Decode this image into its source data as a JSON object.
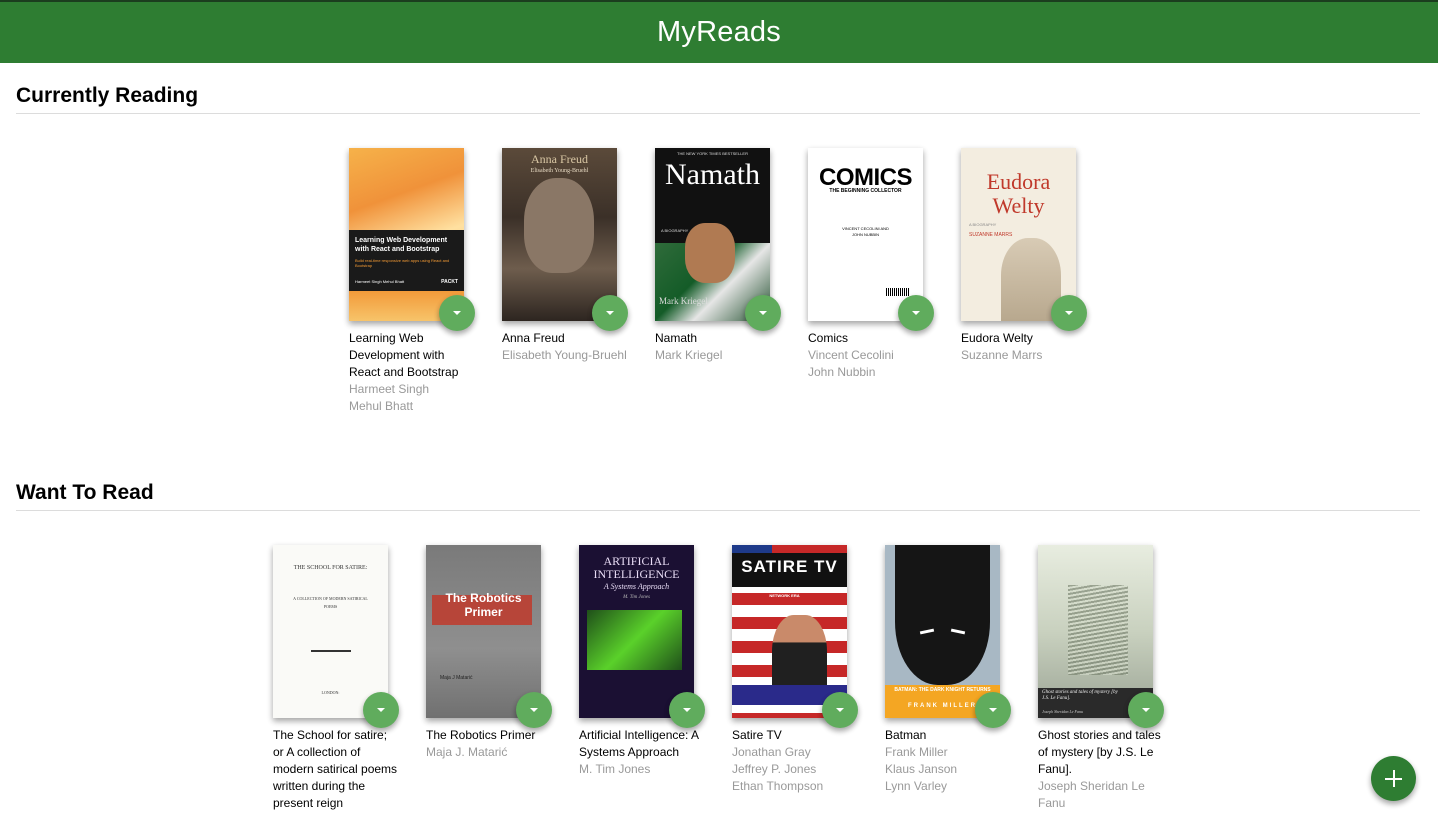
{
  "app": {
    "title": "MyReads"
  },
  "shelves": [
    {
      "title": "Currently Reading",
      "books": [
        {
          "title": "Learning Web Development with React and Bootstrap",
          "authors": [
            "Harmeet Singh",
            "Mehul Bhatt"
          ],
          "cover": {
            "title": "Learning Web Development with React and Bootstrap",
            "subtitle": "Build real-time responsive web apps using React and Bootstrap",
            "authors": "Harmeet Singh  Mehul Bhatt",
            "publisher": "PACKT"
          }
        },
        {
          "title": "Anna Freud",
          "authors": [
            "Elisabeth Young-Bruehl"
          ],
          "cover": {
            "title": "Anna Freud",
            "subtitle": "Elisabeth Young-Bruehl"
          }
        },
        {
          "title": "Namath",
          "authors": [
            "Mark Kriegel"
          ],
          "cover": {
            "title": "Namath",
            "tagline": "THE NEW YORK TIMES BESTSELLER",
            "subtitle": "A BIOGRAPHY",
            "author": "Mark Kriegel"
          }
        },
        {
          "title": "Comics",
          "authors": [
            "Vincent Cecolini",
            "John Nubbin"
          ],
          "cover": {
            "title": "COMICS",
            "subtitle": "THE BEGINNING COLLECTOR",
            "authors": "VINCENT CECOLINI AND JOHN NUBBIN"
          }
        },
        {
          "title": "Eudora Welty",
          "authors": [
            "Suzanne Marrs"
          ],
          "cover": {
            "title": "Eudora Welty",
            "subtitle": "A BIOGRAPHY",
            "author": "SUZANNE MARRS"
          }
        }
      ]
    },
    {
      "title": "Want To Read",
      "books": [
        {
          "title": "The School for satire; or A collection of modern satirical poems written during the present reign",
          "authors": [],
          "cover": {
            "title": "THE SCHOOL FOR SATIRE:",
            "subtitle": "A COLLECTION OF MODERN SATIRICAL POEMS",
            "footer": "LONDON:"
          }
        },
        {
          "title": "The Robotics Primer",
          "authors": [
            "Maja J. Matarić"
          ],
          "cover": {
            "title": "The Robotics Primer",
            "author": "Maja J Matarić"
          }
        },
        {
          "title": "Artificial Intelligence: A Systems Approach",
          "authors": [
            "M. Tim Jones"
          ],
          "cover": {
            "title": "ARTIFICIAL INTELLIGENCE",
            "subtitle": "A Systems Approach",
            "author": "M. Tim Jones"
          }
        },
        {
          "title": "Satire TV",
          "authors": [
            "Jonathan Gray",
            "Jeffrey P. Jones",
            "Ethan Thompson"
          ],
          "cover": {
            "title": "SATIRE TV",
            "subtitle": "POLITICS AND COMEDY IN THE POST-NETWORK ERA"
          }
        },
        {
          "title": "Batman",
          "authors": [
            "Frank Miller",
            "Klaus Janson",
            "Lynn Varley"
          ],
          "cover": {
            "title": "BATMAN: THE DARK KNIGHT RETURNS",
            "author": "FRANK MILLER"
          }
        },
        {
          "title": "Ghost stories and tales of mystery [by J.S. Le Fanu].",
          "authors": [
            "Joseph Sheridan Le Fanu"
          ],
          "cover": {
            "title": "Ghost stories and tales of mystery [by J.S. Le Fanu].",
            "author": "Joseph Sheridan Le Fanu"
          }
        }
      ]
    }
  ],
  "controls": {
    "add_book": "+"
  },
  "colors": {
    "header": "#2e7d32",
    "changer": "#60ac5d",
    "author": "#999999"
  }
}
